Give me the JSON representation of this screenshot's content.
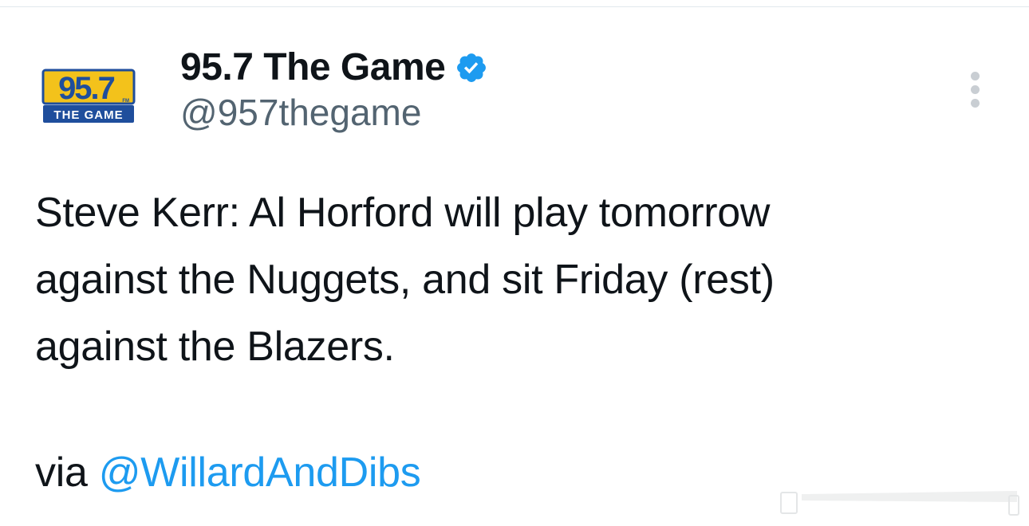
{
  "account": {
    "display_name": "95.7 The Game",
    "handle": "@957thegame",
    "verified": true,
    "avatar": {
      "icon": "957-the-game-logo",
      "logo_number": "95.7",
      "logo_text": "THE GAME",
      "logo_fm": "FM"
    }
  },
  "tweet": {
    "lines": [
      "Steve Kerr: Al Horford will play tomorrow",
      "against the Nuggets, and sit Friday (rest)",
      "against the Blazers."
    ],
    "via_prefix": "via ",
    "via_mention": "@WillardAndDibs"
  },
  "colors": {
    "link": "#1d9bf0",
    "verified_badge": "#1d9bf0",
    "text": "#0f1419",
    "secondary_text": "#536471",
    "logo_yellow": "#f3c21b",
    "logo_blue": "#1f4e9c"
  },
  "icons": {
    "verified": "verified-badge-icon",
    "more": "more-options-icon"
  }
}
